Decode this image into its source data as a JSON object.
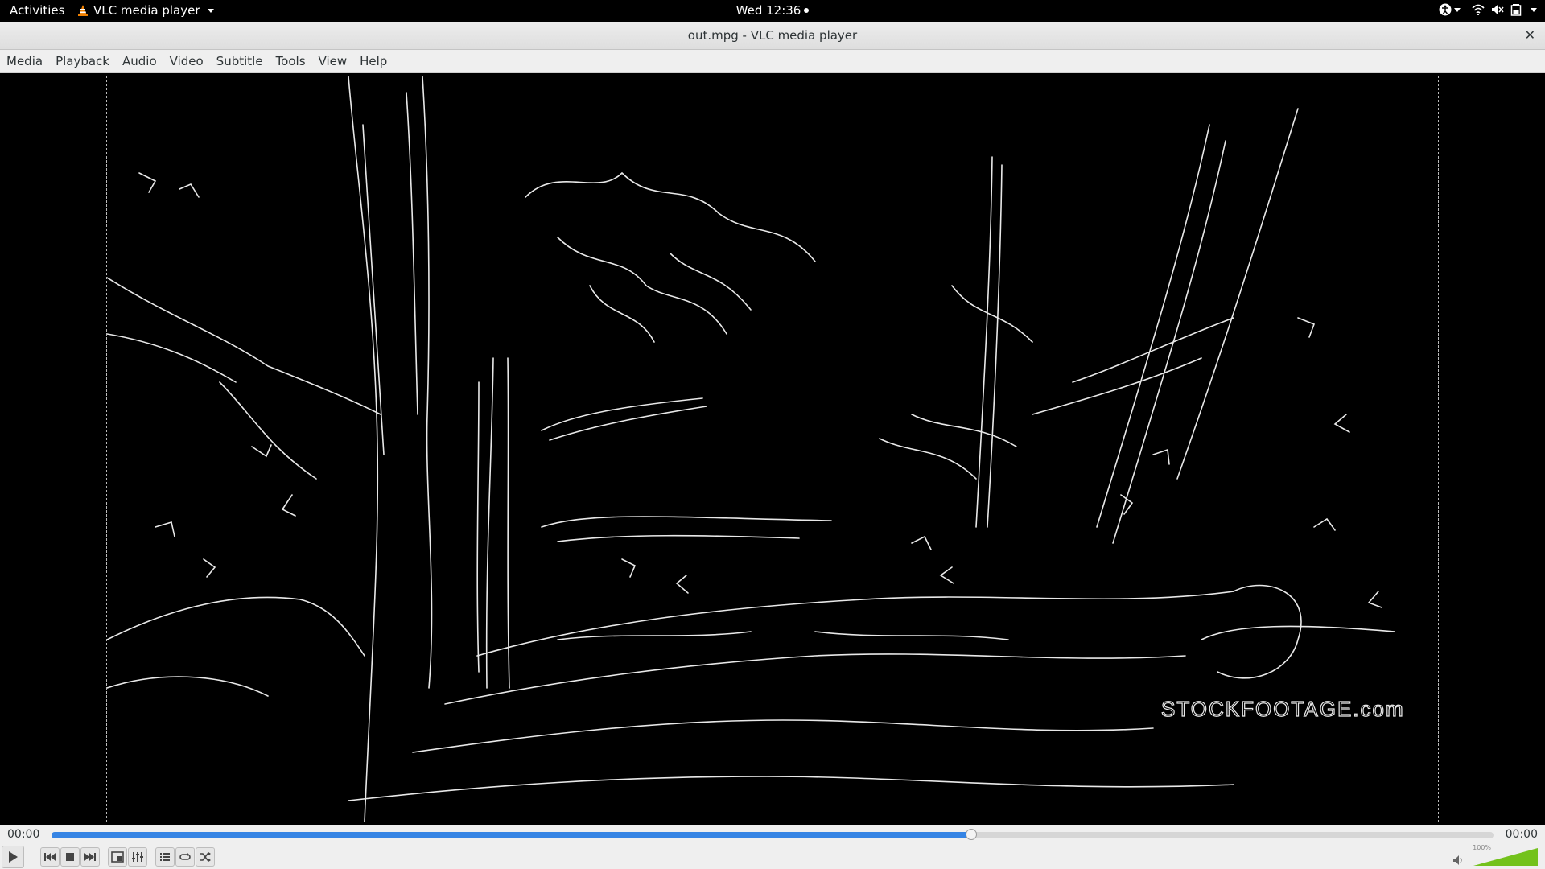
{
  "topbar": {
    "activities": "Activities",
    "app_name": "VLC media player",
    "clock": "Wed 12:36"
  },
  "window": {
    "title": "out.mpg - VLC media player",
    "close_glyph": "✕"
  },
  "menubar": {
    "items": [
      "Media",
      "Playback",
      "Audio",
      "Video",
      "Subtitle",
      "Tools",
      "View",
      "Help"
    ]
  },
  "video": {
    "watermark": "STOCKFOOTAGE.com"
  },
  "controls": {
    "elapsed": "00:00",
    "total": "00:00",
    "seek_fraction": 0.638,
    "volume_label": "100%",
    "volume_fraction": 1.0,
    "buttons": [
      "play",
      "previous",
      "stop",
      "next",
      "fullscreen",
      "extended-settings",
      "playlist",
      "loop",
      "shuffle"
    ]
  },
  "colors": {
    "accent": "#3584e4",
    "vlc_orange": "#f08000",
    "volume_green": "#73c21b"
  }
}
